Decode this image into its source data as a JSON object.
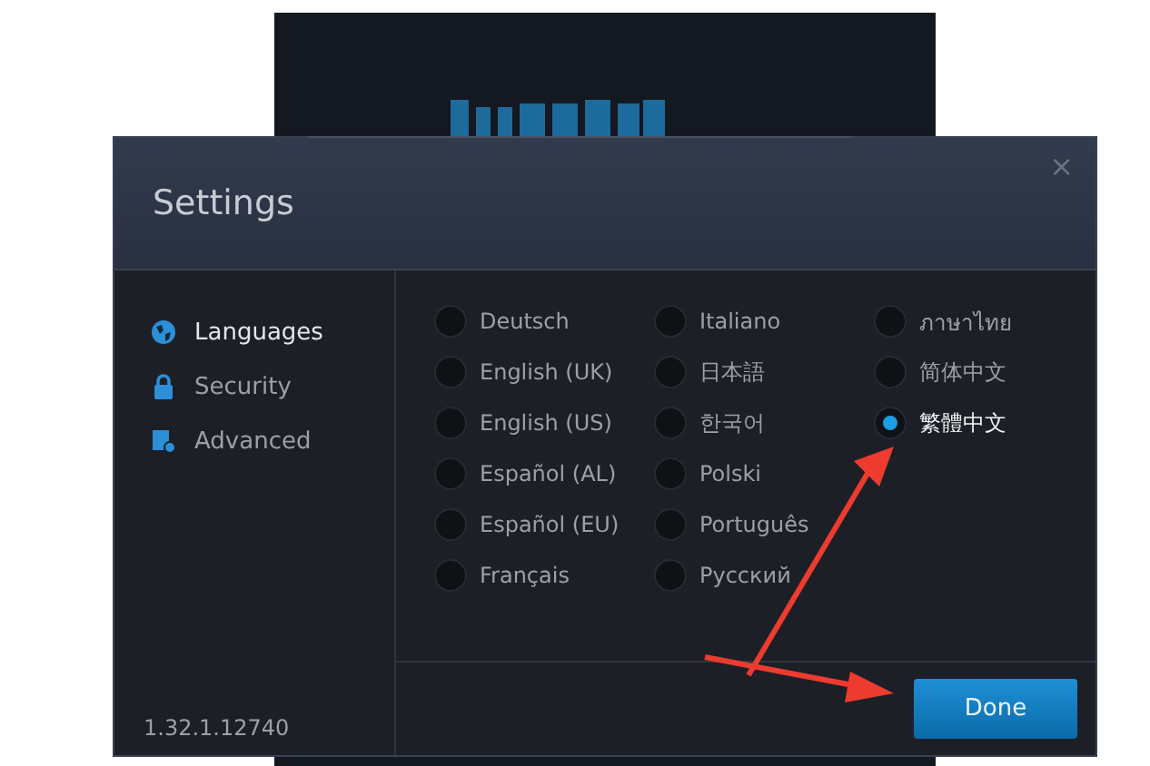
{
  "dialog": {
    "title": "Settings",
    "close": "×"
  },
  "sidebar": {
    "items": [
      {
        "label": "Languages",
        "selected": true
      },
      {
        "label": "Security",
        "selected": false
      },
      {
        "label": "Advanced",
        "selected": false
      }
    ]
  },
  "languages": [
    {
      "label": "Deutsch",
      "selected": false
    },
    {
      "label": "English (UK)",
      "selected": false
    },
    {
      "label": "English (US)",
      "selected": false
    },
    {
      "label": "Español (AL)",
      "selected": false
    },
    {
      "label": "Español (EU)",
      "selected": false
    },
    {
      "label": "Français",
      "selected": false
    },
    {
      "label": "Italiano",
      "selected": false
    },
    {
      "label": "日本語",
      "selected": false
    },
    {
      "label": "한국어",
      "selected": false
    },
    {
      "label": "Polski",
      "selected": false
    },
    {
      "label": "Português",
      "selected": false
    },
    {
      "label": "Русский",
      "selected": false
    },
    {
      "label": "ภาษาไทย",
      "selected": false
    },
    {
      "label": "简体中文",
      "selected": false
    },
    {
      "label": "繁體中文",
      "selected": true
    }
  ],
  "version": "1.32.1.12740",
  "buttons": [
    "Done"
  ]
}
